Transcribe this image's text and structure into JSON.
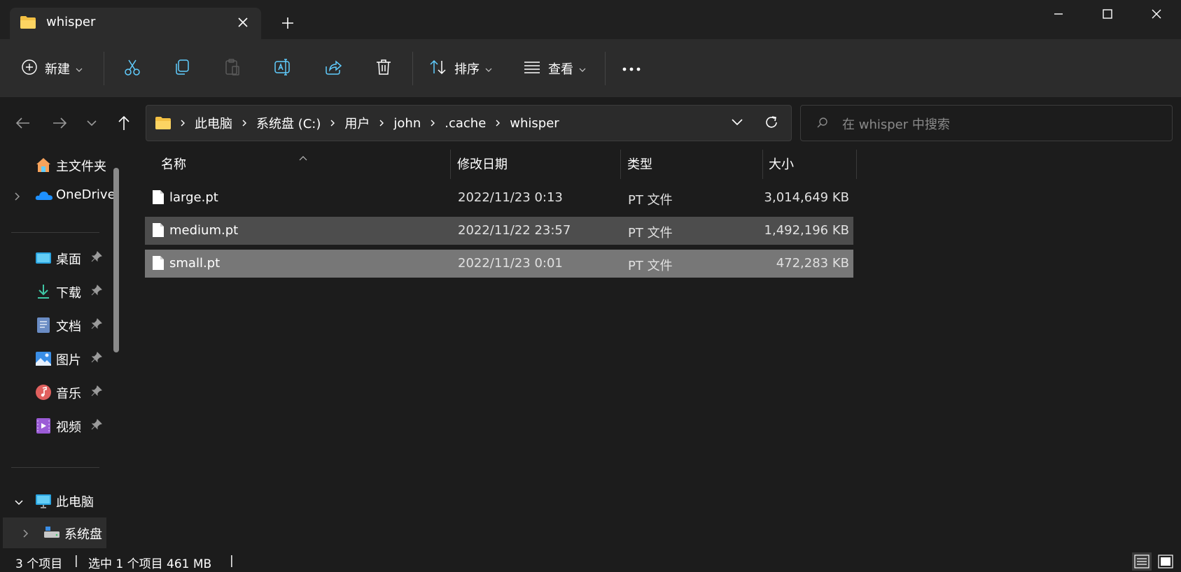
{
  "window": {
    "tab_title": "whisper",
    "tab_close_icon": "close-icon",
    "new_tab_icon": "plus-icon",
    "controls": [
      "minimize-icon",
      "maximize-icon",
      "close-icon"
    ]
  },
  "toolbar": {
    "new_label": "新建",
    "sort_label": "排序",
    "view_label": "查看",
    "actions": [
      "cut-icon",
      "copy-icon",
      "paste-icon",
      "rename-icon",
      "share-icon",
      "delete-icon"
    ],
    "more_icon": "more-icon"
  },
  "address": {
    "crumbs": [
      "此电脑",
      "系统盘 (C:)",
      "用户",
      "john",
      ".cache",
      "whisper"
    ],
    "search_placeholder": "在 whisper 中搜索"
  },
  "sidebar": {
    "items": [
      {
        "label": "主文件夹",
        "icon": "home-icon"
      },
      {
        "label": "OneDrive",
        "icon": "onedrive-icon"
      },
      {
        "label": "桌面",
        "icon": "desktop-icon",
        "pinned": true
      },
      {
        "label": "下载",
        "icon": "download-icon",
        "pinned": true
      },
      {
        "label": "文档",
        "icon": "documents-icon",
        "pinned": true
      },
      {
        "label": "图片",
        "icon": "pictures-icon",
        "pinned": true
      },
      {
        "label": "音乐",
        "icon": "music-icon",
        "pinned": true
      },
      {
        "label": "视频",
        "icon": "videos-icon",
        "pinned": true
      },
      {
        "label": "此电脑",
        "icon": "this-pc-icon"
      },
      {
        "label": "系统盘",
        "icon": "drive-icon"
      }
    ]
  },
  "columns": {
    "name": "名称",
    "date": "修改日期",
    "type": "类型",
    "size": "大小"
  },
  "files": [
    {
      "name": "large.pt",
      "date": "2022/11/23 0:13",
      "type": "PT 文件",
      "size": "3,014,649 KB"
    },
    {
      "name": "medium.pt",
      "date": "2022/11/22 23:57",
      "type": "PT 文件",
      "size": "1,492,196 KB"
    },
    {
      "name": "small.pt",
      "date": "2022/11/23 0:01",
      "type": "PT 文件",
      "size": "472,283 KB"
    }
  ],
  "status": {
    "count": "3 个项目",
    "selection": "选中 1 个项目  461 MB"
  },
  "colors": {
    "background": "#1c1c1c",
    "toolbar": "#2c2c2c",
    "selected_row": "#777777",
    "hover_row": "#4d4d4d",
    "accent": "#60cdff"
  }
}
